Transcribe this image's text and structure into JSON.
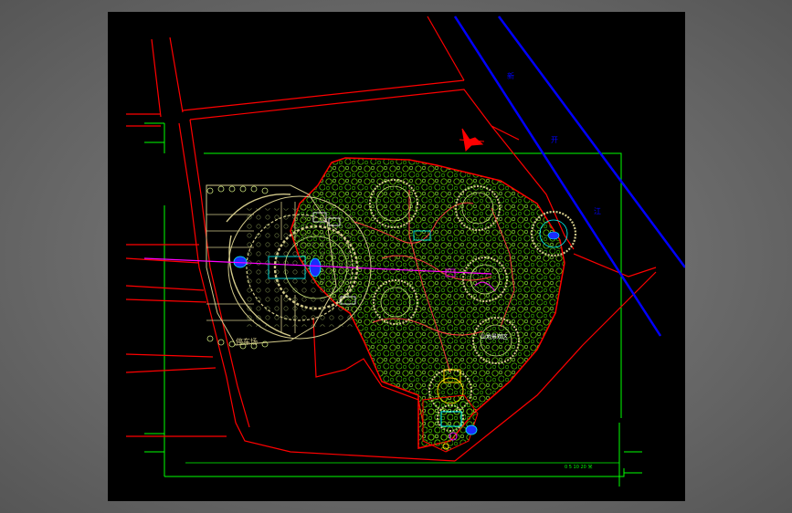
{
  "drawing": {
    "labels": {
      "parking": "停车场",
      "road_char_1": "新",
      "road_char_2": "开",
      "road_char_3": "江",
      "area_label": "山地景观区",
      "scale_note": "0 5 10 20 米"
    },
    "colors": {
      "background": "#000000",
      "road_line": "#ff0000",
      "river_line": "#0000ff",
      "frame_line": "#00ff00",
      "vegetation": "#7cfc00",
      "plaza_ring": "#d2c98a",
      "axis_line": "#ff00ff"
    }
  }
}
